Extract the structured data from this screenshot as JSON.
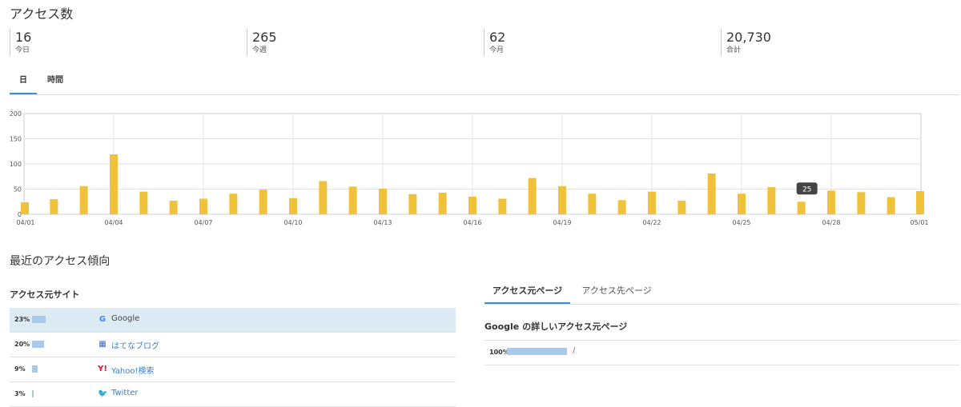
{
  "page_title": "アクセス数",
  "stats": [
    {
      "value": "16",
      "label": "今日"
    },
    {
      "value": "265",
      "label": "今週"
    },
    {
      "value": "62",
      "label": "今月"
    },
    {
      "value": "20,730",
      "label": "合計"
    }
  ],
  "tabs": [
    {
      "label": "日",
      "active": true
    },
    {
      "label": "時間",
      "active": false
    }
  ],
  "chart_data": {
    "type": "bar",
    "categories": [
      "04/01",
      "04/02",
      "04/03",
      "04/04",
      "04/05",
      "04/06",
      "04/07",
      "04/08",
      "04/09",
      "04/10",
      "04/11",
      "04/12",
      "04/13",
      "04/14",
      "04/15",
      "04/16",
      "04/17",
      "04/18",
      "04/19",
      "04/20",
      "04/21",
      "04/22",
      "04/23",
      "04/24",
      "04/25",
      "04/26",
      "04/27",
      "04/28",
      "04/29",
      "04/30",
      "05/01"
    ],
    "x_tick_labels": [
      "04/01",
      "04/04",
      "04/07",
      "04/10",
      "04/13",
      "04/16",
      "04/19",
      "04/22",
      "04/25",
      "04/28",
      "05/01"
    ],
    "y_tick_labels": [
      "0",
      "50",
      "100",
      "150",
      "200"
    ],
    "values": [
      24,
      30,
      56,
      119,
      45,
      27,
      31,
      41,
      49,
      32,
      66,
      55,
      51,
      40,
      43,
      35,
      31,
      72,
      56,
      41,
      28,
      45,
      27,
      81,
      41,
      54,
      25,
      47,
      44,
      34,
      46
    ],
    "ylim": [
      0,
      200
    ],
    "bar_color": "#f0c23c",
    "grid": true,
    "tooltip": {
      "index": 26,
      "text": "25"
    }
  },
  "recent_title": "最近のアクセス傾向",
  "referrers": {
    "title": "アクセス元サイト",
    "items": [
      {
        "pct": "23%",
        "fraction": 0.23,
        "name": "Google",
        "icon": "google-icon",
        "glyph": "G",
        "color": "#4285f4",
        "highlight": true,
        "link": false
      },
      {
        "pct": "20%",
        "fraction": 0.2,
        "name": "はてなブログ",
        "icon": "hatena-blog-icon",
        "glyph": "▦",
        "color": "#3b6ec4",
        "highlight": false,
        "link": true
      },
      {
        "pct": "9%",
        "fraction": 0.09,
        "name": "Yahoo!検索",
        "icon": "yahoo-icon",
        "glyph": "Y!",
        "color": "#ff0033",
        "highlight": false,
        "link": true
      },
      {
        "pct": "3%",
        "fraction": 0.03,
        "name": "Twitter",
        "icon": "twitter-icon",
        "glyph": "🐦",
        "color": "#1da1f2",
        "highlight": false,
        "link": true
      }
    ]
  },
  "pages_tabs": [
    {
      "label": "アクセス元ページ",
      "active": true
    },
    {
      "label": "アクセス先ページ",
      "active": false
    }
  ],
  "pages_detail": {
    "title": "Google の詳しいアクセス元ページ",
    "items": [
      {
        "pct": "100%",
        "fraction": 1.0,
        "path": "/"
      }
    ]
  }
}
